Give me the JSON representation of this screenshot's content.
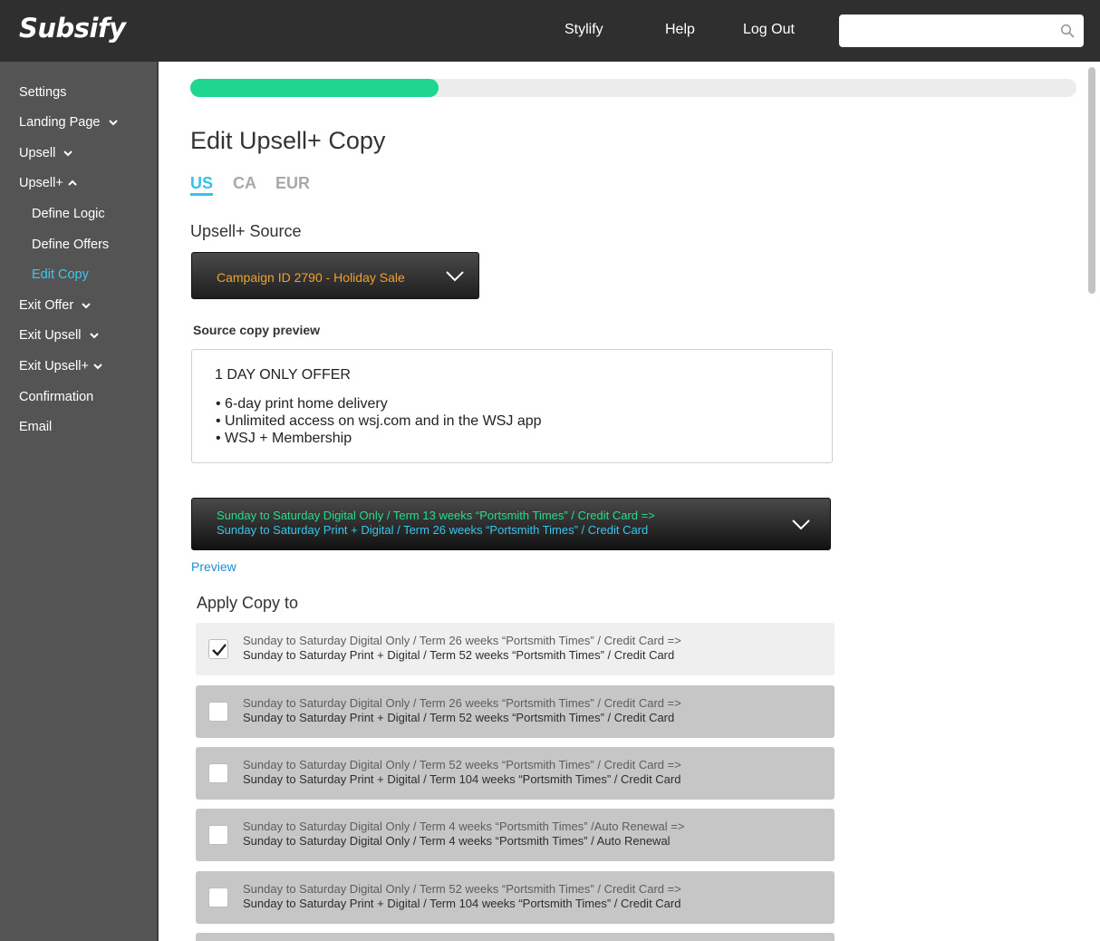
{
  "app": {
    "logo": "Subsify"
  },
  "topnav": {
    "items": [
      "Stylify",
      "Help",
      "Log Out"
    ]
  },
  "search": {
    "value": "",
    "icon": "search-icon"
  },
  "sidebar": {
    "items": [
      {
        "label": "Settings"
      },
      {
        "label": "Landing Page",
        "icon": "chevron-down-icon"
      },
      {
        "label": "Upsell",
        "icon": "chevron-down-icon"
      },
      {
        "label": "Upsell+",
        "icon": "chevron-up-icon"
      },
      {
        "label": "Define Logic"
      },
      {
        "label": "Define Offers"
      },
      {
        "label": "Edit Copy",
        "active": true
      },
      {
        "label": "Exit Offer",
        "icon": "chevron-down-icon"
      },
      {
        "label": "Exit Upsell",
        "icon": "chevron-down-icon"
      },
      {
        "label": "Exit Upsell+",
        "icon": "chevron-down-icon"
      },
      {
        "label": "Confirmation"
      },
      {
        "label": "Email"
      }
    ],
    "active_color": "#3ec8ee"
  },
  "progress": {
    "fraction": 0.28,
    "color": "#1ed68f"
  },
  "main": {
    "title": "Edit Upsell+ Copy",
    "tabs": [
      {
        "label": "US",
        "active": true
      },
      {
        "label": "CA"
      },
      {
        "label": "EUR"
      }
    ],
    "source": {
      "label": "Upsell+ Source",
      "selected": "Campaign ID 2790 - Holiday Sale"
    },
    "preview": {
      "label": "Source copy preview",
      "heading": "1 DAY ONLY OFFER",
      "bullets": [
        "• 6-day print home delivery",
        "• Unlimited access on wsj.com and in the WSJ app",
        "• WSJ + Membership"
      ]
    },
    "offer_select": {
      "line1": "Sunday to Saturday Digital Only / Term 13 weeks “Portsmith Times” / Credit Card =>",
      "line2": "Sunday to Saturday Print + Digital / Term 26 weeks “Portsmith Times” / Credit Card"
    },
    "preview_link": "Preview",
    "apply": {
      "label": "Apply Copy to",
      "rows": [
        {
          "checked": true,
          "line1": "Sunday to Saturday Digital Only / Term 26 weeks “Portsmith Times” / Credit Card =>",
          "line2": "Sunday to Saturday Print + Digital / Term 52 weeks “Portsmith Times” / Credit Card"
        },
        {
          "checked": false,
          "line1": "Sunday to Saturday Digital Only / Term 26 weeks “Portsmith Times” / Credit Card =>",
          "line2": "Sunday to Saturday Print + Digital / Term 52 weeks “Portsmith Times” / Credit Card"
        },
        {
          "checked": false,
          "line1": "Sunday to Saturday Digital Only / Term 52 weeks “Portsmith Times” / Credit Card =>",
          "line2": "Sunday to Saturday Print + Digital / Term 104 weeks “Portsmith Times” / Credit Card"
        },
        {
          "checked": false,
          "line1": "Sunday to Saturday Digital Only / Term 4 weeks “Portsmith Times” /Auto Renewal =>",
          "line2": "Sunday to Saturday Digital Only / Term 4 weeks “Portsmith Times” / Auto Renewal"
        },
        {
          "checked": false,
          "line1": "Sunday to Saturday Digital Only / Term 52 weeks “Portsmith Times” / Credit Card =>",
          "line2": "Sunday to Saturday Print + Digital / Term 104 weeks “Portsmith Times” / Credit Card"
        }
      ]
    }
  },
  "colors": {
    "topbar": "#2f2f2f",
    "sidebar": "#545454",
    "accent": "#36c1ea",
    "offer_green": "#29db8f",
    "source_orange": "#f0a02e"
  }
}
